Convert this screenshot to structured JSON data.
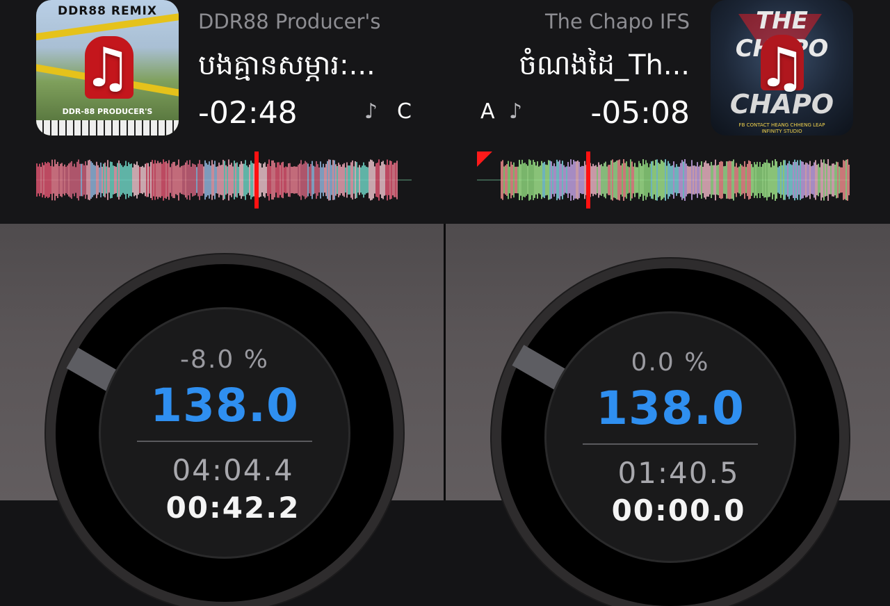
{
  "deck_a": {
    "artist": "DDR88 Producer's",
    "title": "បងគ្មានសម្ភារ:...",
    "time_remaining": "-02:48",
    "note_glyph": "♪",
    "key": "C",
    "artwork": {
      "banner": "DDR88 REMIX",
      "footer": "DDR-88 PRODUCER'S",
      "icon": "music-note-icon"
    },
    "pitch": "-8.0 %",
    "bpm": "138.0",
    "position": "04:04.4",
    "position_secondary": "00:42.2",
    "playhead_fraction": 0.61
  },
  "deck_b": {
    "artist": "The Chapo IFS",
    "title": "ចំណងដៃ_Th...",
    "time_remaining": "-05:08",
    "note_glyph": "♪",
    "key": "A",
    "artwork": {
      "word_top": "THE CHAPO",
      "word_bottom": "CHAPO",
      "caption": "FB CONTACT  HEANG CHHENG LEAP",
      "caption2": "INFINITY STUDIO",
      "icon": "music-note-icon"
    },
    "pitch": "0.0 %",
    "bpm": "138.0",
    "position": "01:40.5",
    "position_secondary": "00:00.0",
    "playhead_fraction": 0.25
  },
  "colors": {
    "bpm": "#2f8ff0",
    "playhead": "#ff1111",
    "background": "#141416"
  }
}
